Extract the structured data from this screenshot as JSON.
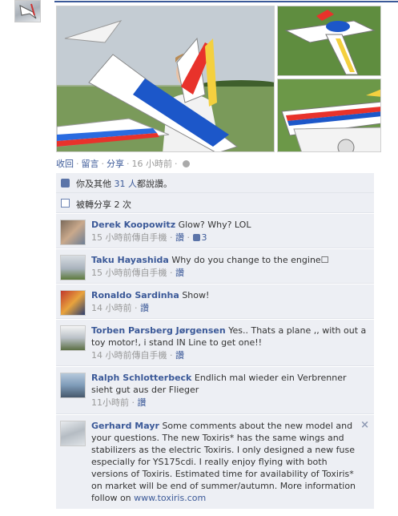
{
  "photos": {
    "main_alt": "man holding model plane",
    "thumb_top_alt": "model plane on grass",
    "thumb_bottom_alt": "model plane closeup"
  },
  "actions": {
    "unlike": "收回",
    "comment": "留言",
    "share": "分享",
    "time": "16 小時前"
  },
  "likes": {
    "prefix": "你及其他",
    "count_link": "31 人",
    "suffix": "都說讚。"
  },
  "shares": {
    "text": "被轉分享 2 次"
  },
  "comments": [
    {
      "author": "Derek Koopowitz",
      "text": "Glow? Why? LOL",
      "time": "15 小時前傳自手機",
      "like_label": "讚",
      "like_count": "3"
    },
    {
      "author": "Taku Hayashida",
      "text": "Why do you change to the engine☐",
      "time": "15 小時前傳自手機",
      "like_label": "讚"
    },
    {
      "author": "Ronaldo Sardinha",
      "text": "Show!",
      "time": "14 小時前",
      "like_label": "讚"
    },
    {
      "author": "Torben Parsberg Jørgensen",
      "text": "Yes.. Thats a plane ,, with out a toy motor!, i stand IN Line to get one!!",
      "time": "14 小時前傳自手機",
      "like_label": "讚"
    },
    {
      "author": "Ralph Schlotterbeck",
      "text": "Endlich mal wieder ein Verbrenner sieht gut aus der Flieger",
      "time": "11小時前",
      "like_label": "讚"
    },
    {
      "author": "Gerhard Mayr",
      "text": "Some comments about the new model and your questions. The new Toxiris* has the same wings and stabilizers as the electric Toxiris. I only designed a new fuse especially for YS175cdi. I really enjoy flying with both versions of Toxiris. Estimated time for availability of Toxiris* on market will be end of summer/autumn. More information follow on",
      "link": "www.toxiris.com",
      "close": "×"
    }
  ],
  "colors": {
    "link": "#3b5998",
    "panel": "#edeff4",
    "meta": "#999999"
  }
}
